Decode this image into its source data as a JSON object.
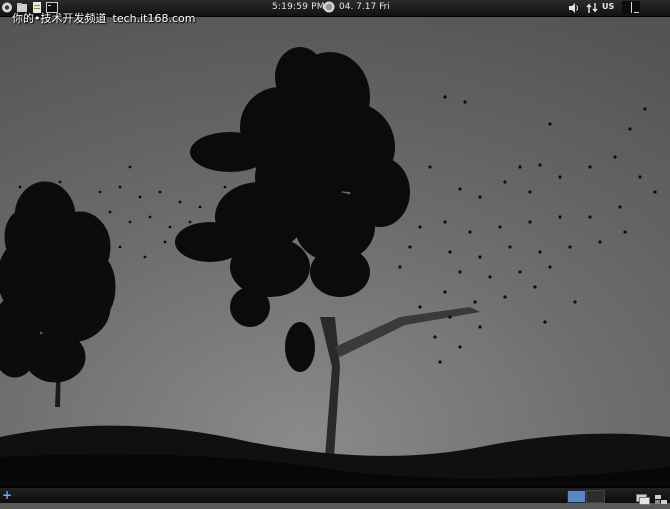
{
  "topbar": {
    "clock": "5:19:59 PM",
    "date": "04. 7.17 Fri",
    "keyboard_layout": "US",
    "launcher_icons": [
      "system-menu-icon",
      "file-manager-icon",
      "text-editor-icon",
      "terminal-icon"
    ]
  },
  "watermark": {
    "site_name": "你的•技术开发频道",
    "url": "tech.it168.com"
  },
  "bottombar": {
    "workspace_count": 2,
    "active_workspace": 1
  },
  "colors": {
    "sky_top": "#5f5f5f",
    "sky_bottom": "#707070",
    "silhouette": "#0a0a0a",
    "hills": "#111111",
    "active_workspace": "#5b86c2"
  }
}
